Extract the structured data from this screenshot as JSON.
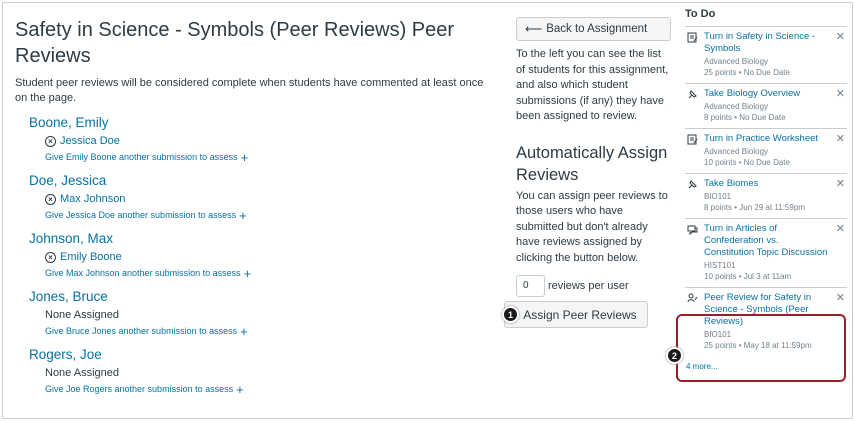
{
  "main": {
    "title": "Safety in Science - Symbols (Peer Reviews) Peer Reviews",
    "description": "Student peer reviews will be considered complete when students have commented at least once on the page.",
    "students": [
      {
        "name": "Boone, Emily",
        "assigned": "Jessica Doe",
        "give": "Give Emily Boone another submission to assess"
      },
      {
        "name": "Doe, Jessica",
        "assigned": "Max Johnson",
        "give": "Give Jessica Doe another submission to assess"
      },
      {
        "name": "Johnson, Max",
        "assigned": "Emily Boone",
        "give": "Give Max Johnson another submission to assess"
      },
      {
        "name": "Jones, Bruce",
        "assigned": "None Assigned",
        "give": "Give Bruce Jones another submission to assess"
      },
      {
        "name": "Rogers, Joe",
        "assigned": "None Assigned",
        "give": "Give Joe Rogers another submission to assess"
      }
    ]
  },
  "right": {
    "back_label": "Back to Assignment",
    "intro": "To the left you can see the list of students for this assignment, and also which student submissions (if any) they have been assigned to review.",
    "auto_title": "Automatically Assign Reviews",
    "auto_text": "You can assign peer reviews to those users who have submitted but don't already have reviews assigned by clicking the button below.",
    "reviews_value": "0",
    "reviews_label": "reviews per user",
    "assign_label": "Assign Peer Reviews",
    "callout_1": "1",
    "callout_2": "2"
  },
  "sidebar": {
    "title": "To Do",
    "items": [
      {
        "icon": "assignment-icon",
        "title": "Turn in Safety in Science - Symbols",
        "course": "Advanced Biology",
        "meta": "25 points • No Due Date"
      },
      {
        "icon": "quiz-icon",
        "title": "Take Biology Overview",
        "course": "Advanced Biology",
        "meta": "8 points • No Due Date"
      },
      {
        "icon": "assignment-icon",
        "title": "Turn in Practice Worksheet",
        "course": "Advanced Biology",
        "meta": "10 points • No Due Date"
      },
      {
        "icon": "quiz-icon",
        "title": "Take Biomes",
        "course": "BIO101",
        "meta": "8 points • Jun 29 at 11:59pm"
      },
      {
        "icon": "discussion-icon",
        "title": "Turn in Articles of Confederation vs. Constitution Topic Discussion",
        "course": "HIST101",
        "meta": "10 points • Jul 3 at 11am"
      },
      {
        "icon": "peer-review-icon",
        "title": "Peer Review for Safety in Science - Symbols (Peer Reviews)",
        "course": "BIO101",
        "meta": "25 points • May 18 at 11:59pm"
      }
    ],
    "more": "4 more..."
  },
  "colors": {
    "link": "#0770a3",
    "text": "#2d3b45",
    "highlight": "#9b1c2c"
  }
}
